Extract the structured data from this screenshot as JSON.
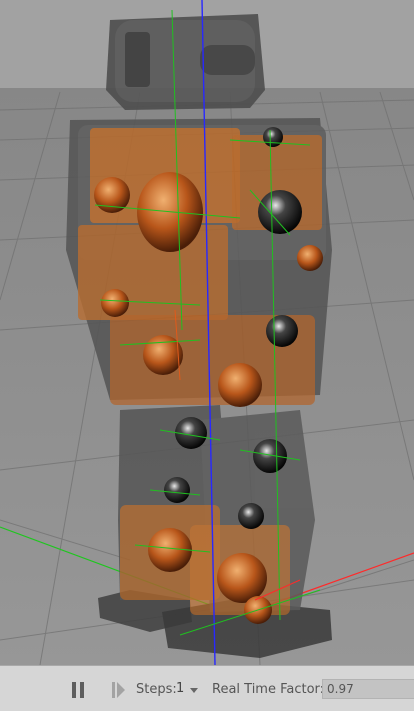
{
  "toolbar": {
    "steps_label": "Steps:",
    "steps_value": "1",
    "rtf_label": "Real Time Factor:",
    "rtf_value": "0.97"
  },
  "icons": {
    "pause": "pause-icon",
    "step": "step-forward-icon",
    "dropdown": "chevron-down-icon"
  },
  "colors": {
    "ground": "#8d8d8d",
    "sky": "#a0a0a0",
    "link_orange": "#d2691e",
    "robot_shell": "#555555",
    "axis_x": "#ff2020",
    "axis_y": "#20c020",
    "axis_z": "#2020ff",
    "toolbar_bg": "#d6d6d6"
  }
}
